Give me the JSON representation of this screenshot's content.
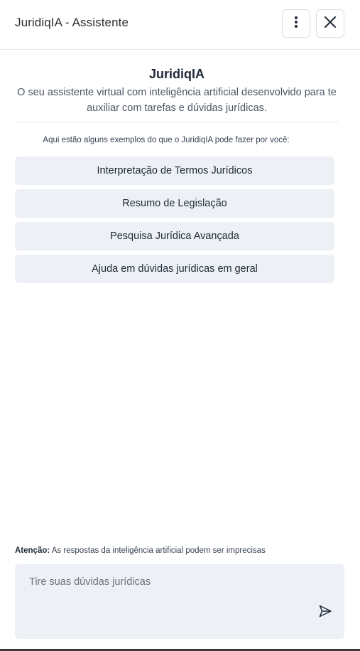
{
  "header": {
    "title": "JuridiqIA - Assistente",
    "more_icon": "more-vertical-icon",
    "close_icon": "close-icon"
  },
  "intro": {
    "title": "JuridiqIA",
    "description": "O seu assistente virtual com inteligência artificial desenvolvido para te auxiliar com tarefas e dúvidas jurídicas."
  },
  "examples": {
    "caption": "Aqui estão alguns exemplos do que o JuridiqIA pode fazer por você:",
    "items": [
      {
        "label": "Interpretação de Termos Jurídicos"
      },
      {
        "label": "Resumo de Legislação"
      },
      {
        "label": "Pesquisa Jurídica Avançada"
      },
      {
        "label": "Ajuda em dúvidas jurídicas em geral"
      }
    ]
  },
  "notice": {
    "label": "Atenção:",
    "text": " As respostas da inteligência artificial podem ser imprecisas"
  },
  "composer": {
    "placeholder": "Tire suas dúvidas jurídicas",
    "value": "",
    "send_icon": "send-icon"
  },
  "colors": {
    "suggestion_bg": "#edf1f5",
    "border": "#d9dde3",
    "text": "#1f2937"
  }
}
